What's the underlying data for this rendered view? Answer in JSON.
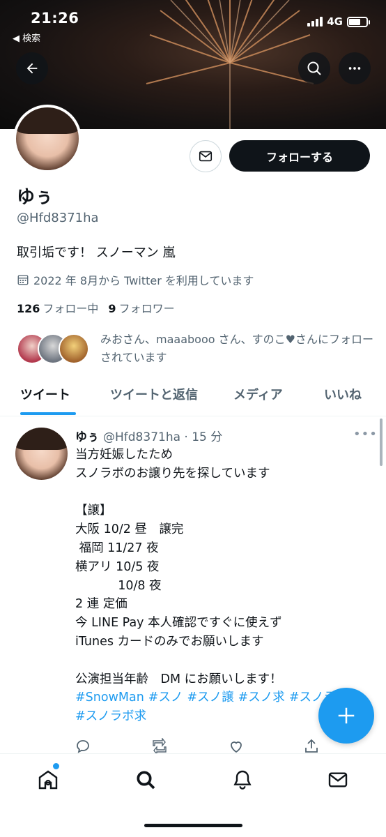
{
  "status_bar": {
    "time": "21:26",
    "back_label": "◀ 検索",
    "network": "4G"
  },
  "header": {
    "back_icon": "arrow-left-icon",
    "search_icon": "search-icon",
    "more_icon": "more-icon"
  },
  "profile": {
    "follow_label": "フォローする",
    "name": "ゆぅ",
    "handle": "@Hfd8371ha",
    "bio": "取引垢です！ スノーマン 嵐",
    "joined": "2022 年 8月から Twitter を利用しています",
    "following_count": "126",
    "following_label": "フォロー中",
    "followers_count": "9",
    "followers_label": "フォロワー",
    "followed_by": "みおさん、maaabooo さん、すのこ♥さんにフォローされています"
  },
  "tabs": [
    {
      "label": "ツイート"
    },
    {
      "label": "ツイートと返信"
    },
    {
      "label": "メディア"
    },
    {
      "label": "いいね"
    }
  ],
  "tweet": {
    "name": "ゆぅ",
    "meta": "@Hfd8371ha · 15 分",
    "lines": [
      "当方妊娠したため",
      "スノラボのお譲り先を探しています",
      "",
      "【譲】",
      "大阪 10/2 昼　譲完",
      " 福岡 11/27 夜",
      "横アリ 10/5 夜",
      "           10/8 夜",
      "2 連 定価",
      "今 LINE Pay 本人確認ですぐに使えず",
      "iTunes カードのみでお願いします",
      "",
      "公演担当年齢　DM にお願いします！"
    ],
    "hashtags": [
      "#SnowMan",
      "#スノ",
      "#スノ譲",
      "#スノ求",
      "#スノラボ譲",
      "#スノラボ求"
    ]
  },
  "colors": {
    "accent": "#1d9bf0",
    "text": "#0f1419",
    "muted": "#536471"
  }
}
